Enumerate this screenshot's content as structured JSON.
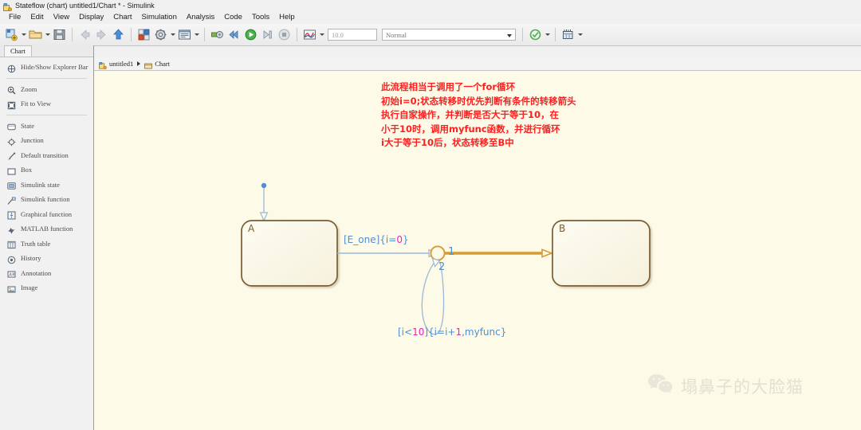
{
  "window": {
    "title": "Stateflow (chart) untitled1/Chart * - Simulink",
    "icon": "stateflow-chart-icon"
  },
  "menubar": {
    "items": [
      {
        "label": "File"
      },
      {
        "label": "Edit"
      },
      {
        "label": "View"
      },
      {
        "label": "Display"
      },
      {
        "label": "Chart"
      },
      {
        "label": "Simulation"
      },
      {
        "label": "Analysis"
      },
      {
        "label": "Code"
      },
      {
        "label": "Tools"
      },
      {
        "label": "Help"
      }
    ]
  },
  "toolbar": {
    "new_model_icon": "new-model-icon",
    "open_icon": "open-folder-icon",
    "save_icon": "save-icon",
    "back_icon": "back-arrow-icon",
    "forward_icon": "forward-arrow-icon",
    "up_icon": "up-arrow-icon",
    "library_icon": "library-browser-icon",
    "settings_icon": "model-configuration-icon",
    "model_explorer_icon": "model-explorer-icon",
    "update_icon": "update-model-icon",
    "fast_restart_icon": "fast-restart-icon",
    "run_icon": "run-icon",
    "step_forward_icon": "step-forward-icon",
    "stop_icon": "stop-icon",
    "scope_icon": "scope-icon",
    "check_icon": "performance-advisor-icon",
    "build_icon": "build-model-icon",
    "stop_time_value": "10.0",
    "sim_mode_value": "Normal"
  },
  "left_panel": {
    "tab_label": "Chart",
    "items": [
      {
        "label": "Hide/Show Explorer Bar",
        "icon": "explorer-bar-icon",
        "divider_after": true
      },
      {
        "label": "Zoom",
        "icon": "zoom-icon"
      },
      {
        "label": "Fit to View",
        "icon": "fit-to-view-icon",
        "divider_after": true
      },
      {
        "label": "State",
        "icon": "state-icon"
      },
      {
        "label": "Junction",
        "icon": "junction-icon"
      },
      {
        "label": "Default transition",
        "icon": "default-transition-icon"
      },
      {
        "label": "Box",
        "icon": "box-icon"
      },
      {
        "label": "Simulink state",
        "icon": "simulink-state-icon"
      },
      {
        "label": "Simulink function",
        "icon": "simulink-function-icon"
      },
      {
        "label": "Graphical function",
        "icon": "graphical-function-icon"
      },
      {
        "label": "MATLAB function",
        "icon": "matlab-function-icon"
      },
      {
        "label": "Truth table",
        "icon": "truth-table-icon"
      },
      {
        "label": "History",
        "icon": "history-junction-icon"
      },
      {
        "label": "Annotation",
        "icon": "annotation-icon"
      },
      {
        "label": "Image",
        "icon": "image-icon"
      }
    ]
  },
  "breadcrumb": {
    "model_icon": "model-icon",
    "model_label": "untitled1",
    "chart_icon": "chart-icon",
    "chart_label": "Chart"
  },
  "chart": {
    "annotation_text": "此流程相当于调用了一个for循环\n初始i=0;状态转移时优先判断有条件的转移箭头\n执行自家操作，并判断是否大于等于10，在\n小于10时，调用myfunc函数，并进行循环\ni大于等于10后，状态转移至B中",
    "annotation_color": "#fd2020",
    "state_a_label": "A",
    "state_b_label": "B",
    "transition_1_label_parts": [
      {
        "text": "[E_one]{i=",
        "color": "#4f8fd0"
      },
      {
        "text": "0",
        "color": "#ee22bb"
      },
      {
        "text": "}",
        "color": "#4f8fd0"
      }
    ],
    "transition_2_label_parts": [
      {
        "text": "[i<",
        "color": "#4f8fd0"
      },
      {
        "text": "10",
        "color": "#ee22bb"
      },
      {
        "text": "]{i=i+",
        "color": "#4f8fd0"
      },
      {
        "text": "1",
        "color": "#ee22bb"
      },
      {
        "text": ",myfunc}",
        "color": "#4f8fd0"
      }
    ],
    "junction_order_1": "1",
    "junction_order_2": "2",
    "state_border_color": "#7a5c33",
    "transition_color": "#4f8fd0",
    "active_transition_color": "#d89a34",
    "canvas_color": "#fdfae8"
  },
  "watermark": {
    "logo_icon": "wechat-logo-icon",
    "text": "塌鼻子的大脸猫"
  }
}
